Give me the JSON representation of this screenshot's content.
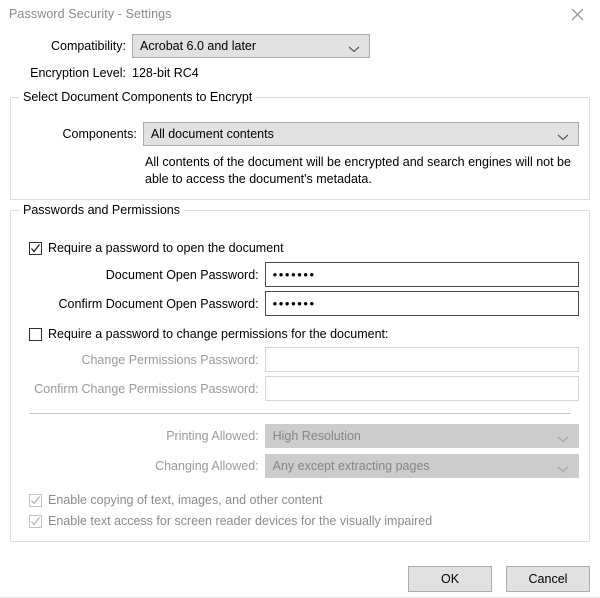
{
  "window": {
    "title": "Password Security - Settings",
    "close_icon": "close-icon"
  },
  "compatibility": {
    "label": "Compatibility:",
    "value": "Acrobat 6.0 and later",
    "chevron_icon": "chevron-down-icon"
  },
  "encryption": {
    "label": "Encryption Level:",
    "value": "128-bit RC4"
  },
  "components_group": {
    "title": "Select Document Components to Encrypt",
    "components_label": "Components:",
    "components_value": "All document contents",
    "chevron_icon": "chevron-down-icon",
    "description": "All contents of the document will be encrypted and search engines will not be able to access the document's metadata."
  },
  "passwords_group": {
    "title": "Passwords and Permissions",
    "require_open_password": {
      "label": "Require a password to open the document",
      "checked": true,
      "enabled": true
    },
    "document_open_password": {
      "label": "Document Open Password:",
      "value": "•••••••"
    },
    "confirm_document_open_password": {
      "label": "Confirm Document Open Password:",
      "value": "•••••••"
    },
    "require_permissions_password": {
      "label": "Require a password to change permissions for the document:",
      "checked": false,
      "enabled": true
    },
    "change_permissions_password": {
      "label": "Change Permissions Password:",
      "value": ""
    },
    "confirm_change_permissions_password": {
      "label": "Confirm Change Permissions Password:",
      "value": ""
    },
    "printing_allowed": {
      "label": "Printing Allowed:",
      "value": "High Resolution",
      "enabled": false
    },
    "changing_allowed": {
      "label": "Changing Allowed:",
      "value": "Any except extracting pages",
      "enabled": false
    },
    "enable_copying": {
      "label": "Enable copying of text, images, and other content",
      "checked": true,
      "enabled": false
    },
    "enable_screen_reader": {
      "label": "Enable text access for screen reader devices for the visually impaired",
      "checked": true,
      "enabled": false
    }
  },
  "footer": {
    "ok_label": "OK",
    "cancel_label": "Cancel"
  },
  "colors": {
    "title_text": "#8a8a8a",
    "combo_bg": "#e1e1e1",
    "combo_disabled_bg": "#cccccc",
    "disabled_text": "#8c8c8c",
    "group_border": "#dedede",
    "input_border": "#4a4a4a"
  }
}
